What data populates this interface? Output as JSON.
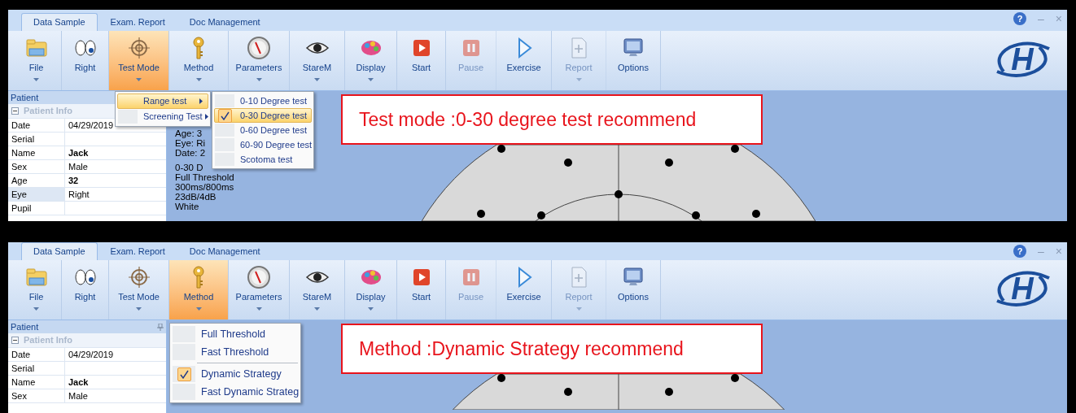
{
  "panels": [
    {
      "tabs": [
        {
          "label": "Data Sample",
          "selected": true
        },
        {
          "label": "Exam. Report",
          "selected": false
        },
        {
          "label": "Doc Management",
          "selected": false
        }
      ],
      "help": "?",
      "window_controls": [
        "–",
        "×"
      ],
      "ribbon": [
        {
          "label": "File",
          "kind": "folder",
          "dropdown": true,
          "selected": false,
          "disabled": false
        },
        {
          "label": "Right",
          "kind": "eyes",
          "dropdown": false,
          "selected": false,
          "disabled": false
        },
        {
          "label": "Test Mode",
          "kind": "target",
          "dropdown": true,
          "selected": true,
          "disabled": false
        },
        {
          "label": "Method",
          "kind": "key",
          "dropdown": true,
          "selected": false,
          "disabled": false
        },
        {
          "label": "Parameters",
          "kind": "gauge",
          "dropdown": true,
          "selected": false,
          "disabled": false
        },
        {
          "label": "StareM",
          "kind": "eye",
          "dropdown": true,
          "selected": false,
          "disabled": false
        },
        {
          "label": "Display",
          "kind": "palette",
          "dropdown": true,
          "selected": false,
          "disabled": false
        },
        {
          "label": "Start",
          "kind": "play",
          "dropdown": false,
          "selected": false,
          "disabled": false
        },
        {
          "label": "Pause",
          "kind": "pause",
          "dropdown": false,
          "selected": false,
          "disabled": true
        },
        {
          "label": "Exercise",
          "kind": "outline-play",
          "dropdown": false,
          "selected": false,
          "disabled": false
        },
        {
          "label": "Report",
          "kind": "document",
          "dropdown": true,
          "selected": false,
          "disabled": true
        },
        {
          "label": "Options",
          "kind": "options",
          "dropdown": false,
          "selected": false,
          "disabled": false
        }
      ],
      "logo": "H",
      "patient": {
        "title": "Patient",
        "pinned": false,
        "section": {
          "label": "Patient Info",
          "expanded": true
        },
        "rows": [
          {
            "label": "Date",
            "value": "04/29/2019",
            "bold": false,
            "selected": false
          },
          {
            "label": "Serial",
            "selected": false
          },
          {
            "label": "Name",
            "value": "Jack",
            "bold": true,
            "selected": false
          },
          {
            "label": "Sex",
            "value": "Male",
            "bold": false,
            "selected": false
          },
          {
            "label": "Age",
            "value": "32",
            "bold": true,
            "selected": false
          },
          {
            "label": "Eye",
            "value": "Right",
            "bold": false,
            "selected": true
          },
          {
            "label": "Pupil",
            "selected": false
          }
        ]
      },
      "info_blocks": [
        [
          "Age: 3",
          "Eye: Ri",
          "Date: 2"
        ],
        [
          "0-30 D",
          "Full Threshold",
          "300ms/800ms",
          "23dB/4dB",
          "White"
        ]
      ],
      "menus": [
        {
          "kind": "compact",
          "items": [
            {
              "label": "Range test",
              "submenu": true,
              "selected": true
            },
            {
              "label": "Screening Test",
              "submenu": true,
              "selected": false
            }
          ]
        },
        {
          "kind": "compact",
          "items": [
            {
              "label": "0-10 Degree test",
              "selected": false,
              "checked": false
            },
            {
              "label": "0-30 Degree test",
              "selected": true,
              "checked": true
            },
            {
              "label": "0-60 Degree test",
              "selected": false,
              "checked": false
            },
            {
              "label": "60-90 Degree test",
              "selected": false,
              "checked": false
            },
            {
              "label": "Scotoma test",
              "selected": false,
              "checked": false
            }
          ]
        }
      ],
      "callout": "Test mode :0-30 degree test recommend"
    },
    {
      "tabs": [
        {
          "label": "Data Sample",
          "selected": true
        },
        {
          "label": "Exam. Report",
          "selected": false
        },
        {
          "label": "Doc Management",
          "selected": false
        }
      ],
      "help": "?",
      "window_controls": [
        "–",
        "×"
      ],
      "ribbon": [
        {
          "label": "File",
          "kind": "folder",
          "dropdown": true,
          "selected": false,
          "disabled": false
        },
        {
          "label": "Right",
          "kind": "eyes",
          "dropdown": false,
          "selected": false,
          "disabled": false
        },
        {
          "label": "Test Mode",
          "kind": "target",
          "dropdown": true,
          "selected": false,
          "disabled": false
        },
        {
          "label": "Method",
          "kind": "key",
          "dropdown": true,
          "selected": true,
          "disabled": false
        },
        {
          "label": "Parameters",
          "kind": "gauge",
          "dropdown": true,
          "selected": false,
          "disabled": false
        },
        {
          "label": "StareM",
          "kind": "eye",
          "dropdown": true,
          "selected": false,
          "disabled": false
        },
        {
          "label": "Display",
          "kind": "palette",
          "dropdown": true,
          "selected": false,
          "disabled": false
        },
        {
          "label": "Start",
          "kind": "play",
          "dropdown": false,
          "selected": false,
          "disabled": false
        },
        {
          "label": "Pause",
          "kind": "pause",
          "dropdown": false,
          "selected": false,
          "disabled": true
        },
        {
          "label": "Exercise",
          "kind": "outline-play",
          "dropdown": false,
          "selected": false,
          "disabled": false
        },
        {
          "label": "Report",
          "kind": "document",
          "dropdown": true,
          "selected": false,
          "disabled": true
        },
        {
          "label": "Options",
          "kind": "options",
          "dropdown": false,
          "selected": false,
          "disabled": false
        }
      ],
      "logo": "H",
      "patient": {
        "title": "Patient",
        "pinned": true,
        "section": {
          "label": "Patient Info",
          "expanded": true
        },
        "rows": [
          {
            "label": "Date",
            "value": "04/29/2019",
            "bold": false,
            "selected": false
          },
          {
            "label": "Serial",
            "selected": false
          },
          {
            "label": "Name",
            "value": "Jack",
            "bold": true,
            "selected": false
          },
          {
            "label": "Sex",
            "value": "Male",
            "bold": false,
            "selected": false
          }
        ]
      },
      "menus": [
        {
          "kind": "large",
          "items": [
            {
              "label": "Full Threshold",
              "checked": false,
              "separator_before": false
            },
            {
              "label": "Fast Threshold",
              "checked": false,
              "separator_before": false
            },
            {
              "label": "Dynamic Strategy",
              "checked": true,
              "separator_before": true
            },
            {
              "label": "Fast Dynamic Strateg",
              "checked": false,
              "separator_before": false
            }
          ]
        }
      ],
      "callout": "Method :Dynamic Strategy recommend"
    }
  ]
}
